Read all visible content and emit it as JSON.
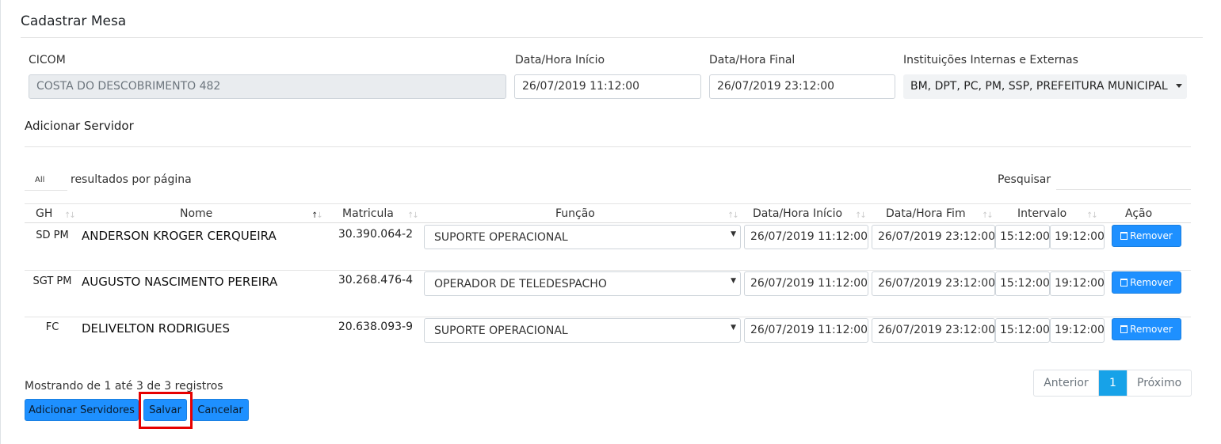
{
  "page": {
    "title": "Cadastrar Mesa"
  },
  "form": {
    "cicom_label": "CICOM",
    "cicom_value": "COSTA DO DESCOBRIMENTO 482",
    "inicio_label": "Data/Hora Início",
    "inicio_value": "26/07/2019 11:12:00",
    "final_label": "Data/Hora Final",
    "final_value": "26/07/2019 23:12:00",
    "instituicoes_label": "Instituições Internas e Externas",
    "instituicoes_value": "BM, DPT, PC, PM, SSP, PREFEITURA MUNICIPAL"
  },
  "section": {
    "title": "Adicionar Servidor"
  },
  "table_controls": {
    "length_value": "All",
    "length_label": "resultados por página",
    "search_label": "Pesquisar"
  },
  "table": {
    "headers": [
      "GH",
      "Nome",
      "Matricula",
      "Função",
      "Data/Hora Início",
      "Data/Hora Fim",
      "Intervalo",
      "Ação"
    ],
    "rows": [
      {
        "gh": "SD PM",
        "nome": "ANDERSON KROGER CERQUEIRA",
        "matricula": "30.390.064-2",
        "funcao": "SUPORTE OPERACIONAL",
        "inicio": "26/07/2019 11:12:00",
        "fim": "26/07/2019 23:12:00",
        "intervalo_inicio": "15:12:00",
        "intervalo_fim": "19:12:00",
        "acao": "Remover"
      },
      {
        "gh": "SGT PM",
        "nome": "AUGUSTO NASCIMENTO PEREIRA",
        "matricula": "30.268.476-4",
        "funcao": "OPERADOR DE TELEDESPACHO",
        "inicio": "26/07/2019 11:12:00",
        "fim": "26/07/2019 23:12:00",
        "intervalo_inicio": "15:12:00",
        "intervalo_fim": "19:12:00",
        "acao": "Remover"
      },
      {
        "gh": "FC",
        "nome": "DELIVELTON RODRIGUES",
        "matricula": "20.638.093-9",
        "funcao": "SUPORTE OPERACIONAL",
        "inicio": "26/07/2019 11:12:00",
        "fim": "26/07/2019 23:12:00",
        "intervalo_inicio": "15:12:00",
        "intervalo_fim": "19:12:00",
        "acao": "Remover"
      }
    ]
  },
  "footer": {
    "info": "Mostrando de 1 até 3 de 3 registros",
    "pager_prev": "Anterior",
    "pager_current": "1",
    "pager_next": "Próximo",
    "btn_add": "Adicionar Servidores",
    "btn_save": "Salvar",
    "btn_cancel": "Cancelar"
  },
  "colors": {
    "primary": "#1e90ff",
    "highlight": "#e60000",
    "pager_active": "#17a2e8"
  }
}
